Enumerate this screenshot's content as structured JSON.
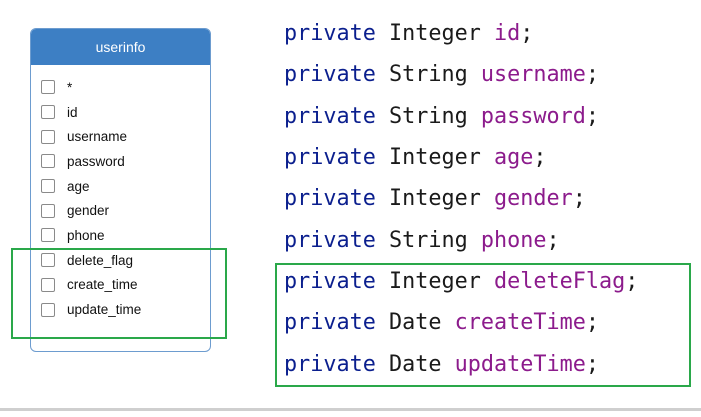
{
  "table": {
    "title": "userinfo",
    "fields": [
      {
        "label": "*"
      },
      {
        "label": "id"
      },
      {
        "label": "username"
      },
      {
        "label": "password"
      },
      {
        "label": "age"
      },
      {
        "label": "gender"
      },
      {
        "label": "phone"
      },
      {
        "label": "delete_flag"
      },
      {
        "label": "create_time"
      },
      {
        "label": "update_time"
      }
    ]
  },
  "code": {
    "lines": [
      {
        "modifier": "private",
        "type": "Integer",
        "name": "id",
        "end": ";"
      },
      {
        "modifier": "private",
        "type": "String",
        "name": "username",
        "end": ";"
      },
      {
        "modifier": "private",
        "type": "String",
        "name": "password",
        "end": ";"
      },
      {
        "modifier": "private",
        "type": "Integer",
        "name": "age",
        "end": ";"
      },
      {
        "modifier": "private",
        "type": "Integer",
        "name": "gender",
        "end": ";"
      },
      {
        "modifier": "private",
        "type": "String",
        "name": "phone",
        "end": ";"
      },
      {
        "modifier": "private",
        "type": "Integer",
        "name": "deleteFlag",
        "end": ";"
      },
      {
        "modifier": "private",
        "type": "Date",
        "name": "createTime",
        "end": ";"
      },
      {
        "modifier": "private",
        "type": "Date",
        "name": "updateTime",
        "end": ";"
      }
    ]
  },
  "colors": {
    "header": "#3d7fc4",
    "keyword": "#0b1f8e",
    "identifier": "#8c1b8c",
    "highlight": "#2aa84a"
  }
}
